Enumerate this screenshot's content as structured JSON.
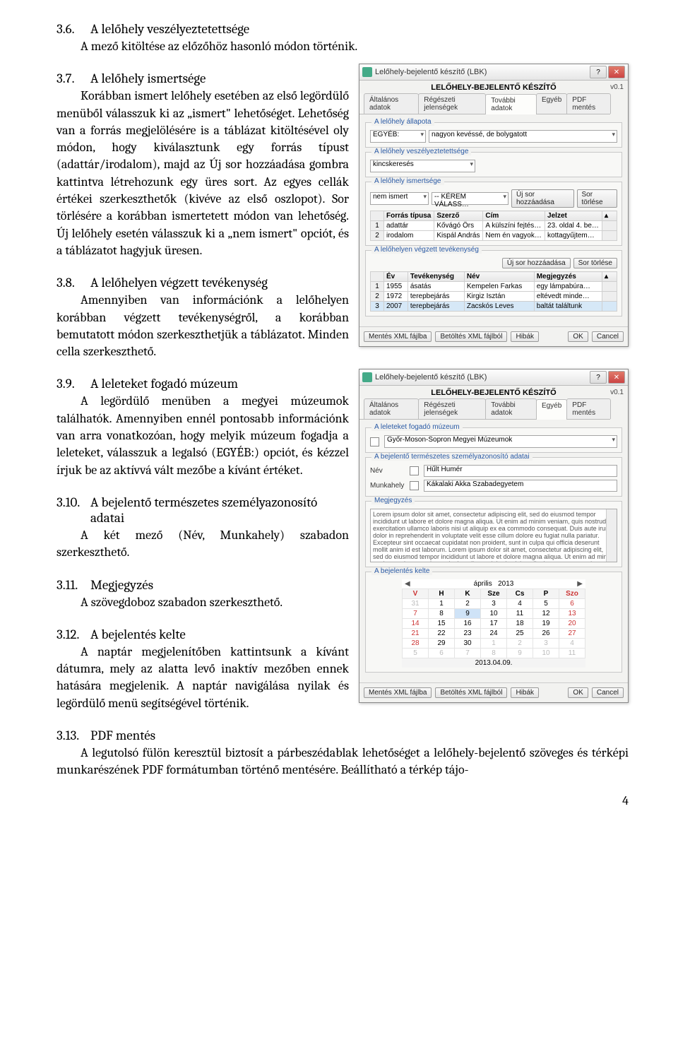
{
  "sections": {
    "s36": {
      "num": "3.6.",
      "title": "A lelőhely veszélyeztetettsége",
      "body": "A mező kitöltése az előzőhöz hasonló módon történik."
    },
    "s37": {
      "num": "3.7.",
      "title": "A lelőhely ismertsége",
      "body": "Korábban ismert lelőhely esetében az első legördülő menüből válasszuk ki az „ismert\" lehetőséget. Lehetőség van a forrás megjelölésére is a táblázat kitöltésével oly módon, hogy kiválasztunk egy forrás típust (adattár/irodalom), majd az Új sor hozzáadása gombra kattintva létrehozunk egy üres sort. Az egyes cellák értékei szerkeszthetők (kivéve az első oszlopot). Sor törlésére a korábban ismertetett módon van lehetőség. Új lelőhely esetén válasszuk ki a „nem ismert\" opciót, és a táblázatot hagyjuk üresen."
    },
    "s38": {
      "num": "3.8.",
      "title": "A lelőhelyen végzett tevékenység",
      "body": "Amennyiben van információnk a lelőhelyen korábban végzett tevékenységről, a korábban bemutatott módon szerkeszthetjük a táblázatot. Minden cella szerkeszthető."
    },
    "s39": {
      "num": "3.9.",
      "title": "A leleteket fogadó múzeum",
      "body": "A legördülő menüben a megyei múzeumok találhatók. Amennyiben ennél pontosabb információnk van arra vonatkozóan, hogy melyik múzeum fogadja a leleteket, válasszuk a legalsó (EGYÉB:) opciót, és kézzel írjuk be az aktívvá vált mezőbe a kívánt értéket."
    },
    "s310": {
      "num": "3.10.",
      "title": "A bejelentő természetes személyazonosító adatai",
      "body": "A két mező (Név, Munkahely) szabadon szerkeszthető."
    },
    "s311": {
      "num": "3.11.",
      "title": "Megjegyzés",
      "body": "A szövegdoboz szabadon szerkeszthető."
    },
    "s312": {
      "num": "3.12.",
      "title": "A bejelentés kelte",
      "body": "A naptár megjelenítőben kattintsunk a kívánt dátumra, mely az alatta levő inaktív mezőben ennek hatására megjelenik. A naptár navigálása nyilak és legördülő menü segítségével történik."
    },
    "s313": {
      "num": "3.13.",
      "title": "PDF mentés",
      "body": "A legutolsó fülön keresztül biztosít a párbeszédablak lehetőséget a lelőhely-bejelentő szöveges és térképi munkarészének PDF formátumban történő mentésére. Beállítható a térkép tájo-"
    }
  },
  "win_title": "Lelőhely-bejelentő készítő (LBK)",
  "app_title": "LELŐHELY-BEJELENTŐ KÉSZÍTŐ",
  "version": "v0.1",
  "tabs": [
    "Általános adatok",
    "Régészeti jelenségek",
    "További adatok",
    "Egyéb",
    "PDF mentés"
  ],
  "shot1": {
    "g_allapot": {
      "title": "A lelőhely állapota",
      "dd1": "EGYÉB:",
      "dd2": "nagyon kevéssé, de bolygatott"
    },
    "g_veszely": {
      "title": "A lelőhely veszélyeztetettsége",
      "dd": "kincskeresés"
    },
    "g_ismert": {
      "title": "A lelőhely ismertsége",
      "dd": "nem ismert",
      "dd2": "-- KÉREM VÁLASS…",
      "btn_add": "Új sor hozzáadása",
      "btn_del": "Sor törlése",
      "cols": [
        "",
        "Forrás típusa",
        "Szerző",
        "Cím",
        "Jelzet"
      ],
      "rows": [
        [
          "1",
          "adattár",
          "Kővágó Örs",
          "A külszíni fejtés…",
          "23. oldal 4. be…"
        ],
        [
          "2",
          "irodalom",
          "Kispál András",
          "Nem én vagyok…",
          "kottagyűjtem…"
        ]
      ]
    },
    "g_tevek": {
      "title": "A lelőhelyen végzett tevékenység",
      "btn_add": "Új sor hozzáadása",
      "btn_del": "Sor törlése",
      "cols": [
        "",
        "Év",
        "Tevékenység",
        "Név",
        "Megjegyzés"
      ],
      "rows": [
        [
          "1",
          "1955",
          "ásatás",
          "Kempelen Farkas",
          "egy lámpabúra…"
        ],
        [
          "2",
          "1972",
          "terepbejárás",
          "Kirgiz Isztán",
          "eltévedt minde…"
        ],
        [
          "3",
          "2007",
          "terepbejárás",
          "Zacskós Leves",
          "baltát találtunk"
        ]
      ]
    },
    "bottom": {
      "save_xml": "Mentés XML fájlba",
      "load_xml": "Betöltés XML fájlból",
      "errors": "Hibák",
      "ok": "OK",
      "cancel": "Cancel"
    }
  },
  "shot2": {
    "g_muzeum": {
      "title": "A leleteket fogadó múzeum",
      "dd": "Győr-Moson-Sopron Megyei Múzeumok"
    },
    "g_szemely": {
      "title": "A bejelentő természetes személyazonosító adatai",
      "name_label": "Név",
      "name_value": "Hűlt Humér",
      "work_label": "Munkahely",
      "work_value": "Kákalaki Akka Szabadegyetem"
    },
    "g_megj": {
      "title": "Megjegyzés",
      "text": "Lorem ipsum dolor sit amet, consectetur adipiscing elit, sed do eiusmod tempor incididunt ut labore et dolore magna aliqua. Ut enim ad minim veniam, quis nostrud exercitation ullamco laboris nisi ut aliquip ex ea commodo consequat. Duis aute irure dolor in reprehenderit in voluptate velit esse cillum dolore eu fugiat nulla pariatur. Excepteur sint occaecat cupidatat non proident, sunt in culpa qui officia deserunt mollit anim id est laborum. Lorem ipsum dolor sit amet, consectetur adipiscing elit, sed do eiusmod tempor incididunt ut labore et dolore magna aliqua. Ut enim ad minim veniam, quis nostrud exercitation ullamco laboris nisi ut aliquip ex ea commodo consequat."
    },
    "g_kelte": {
      "title": "A bejelentés kelte",
      "month": "április",
      "year": "2013",
      "days": [
        "V",
        "H",
        "K",
        "Sze",
        "Cs",
        "P",
        "Szo"
      ],
      "grid": [
        [
          "31",
          "1",
          "2",
          "3",
          "4",
          "5",
          "6"
        ],
        [
          "7",
          "8",
          "9",
          "10",
          "11",
          "12",
          "13"
        ],
        [
          "14",
          "15",
          "16",
          "17",
          "18",
          "19",
          "20"
        ],
        [
          "21",
          "22",
          "23",
          "24",
          "25",
          "26",
          "27"
        ],
        [
          "28",
          "29",
          "30",
          "1",
          "2",
          "3",
          "4"
        ],
        [
          "5",
          "6",
          "7",
          "8",
          "9",
          "10",
          "11"
        ]
      ],
      "selected_date": "2013.04.09."
    },
    "bottom": {
      "save_xml": "Mentés XML fájlba",
      "load_xml": "Betöltés XML fájlból",
      "errors": "Hibák",
      "ok": "OK",
      "cancel": "Cancel"
    }
  },
  "pagenum": "4"
}
